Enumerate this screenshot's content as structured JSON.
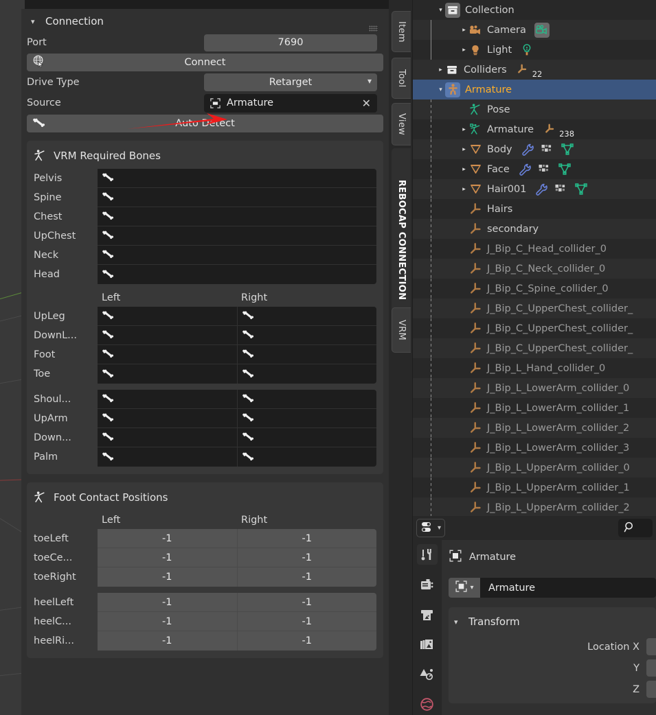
{
  "colors": {
    "accent_select": "#3b5680",
    "name_selected": "#ffaf29",
    "panel_bg": "#303030",
    "subpanel_bg": "#383838",
    "field_bg": "#545454",
    "dark_field_bg": "#1d1d1d",
    "annotation_arrow": "#ee1b1b"
  },
  "npanel": {
    "connection": {
      "title": "Connection",
      "port_label": "Port",
      "port_value": "7690",
      "connect_label": "Connect",
      "connect_icon": "globe-cursor-icon",
      "drive_type_label": "Drive Type",
      "drive_type_value": "Retarget",
      "source_label": "Source",
      "source_value": "Armature",
      "source_icon": "object-data-icon",
      "source_clear_icon": "x-icon",
      "auto_detect_label": "Auto Detect",
      "auto_detect_icon": "bone-icon",
      "grip_icon": "drag-grip-icon"
    },
    "required_bones": {
      "title": "VRM Required Bones",
      "title_icon": "armature-pose-icon",
      "center_rows": [
        "Pelvis",
        "Spine",
        "Chest",
        "UpChest",
        "Neck",
        "Head"
      ],
      "col_left": "Left",
      "col_right": "Right",
      "leg_rows": [
        "UpLeg",
        "DownL...",
        "Foot",
        "Toe"
      ],
      "arm_rows": [
        "Shoul...",
        "UpArm",
        "Down...",
        "Palm"
      ],
      "cell_icon": "bone-icon"
    },
    "foot_contact": {
      "title": "Foot Contact Positions",
      "title_icon": "armature-pose-icon",
      "col_left": "Left",
      "col_right": "Right",
      "toe_rows": [
        {
          "label": "toeLeft",
          "left": "-1",
          "right": "-1"
        },
        {
          "label": "toeCe...",
          "left": "-1",
          "right": "-1"
        },
        {
          "label": "toeRight",
          "left": "-1",
          "right": "-1"
        }
      ],
      "heel_rows": [
        {
          "label": "heelLeft",
          "left": "-1",
          "right": "-1"
        },
        {
          "label": "heelC...",
          "left": "-1",
          "right": "-1"
        },
        {
          "label": "heelRi...",
          "left": "-1",
          "right": "-1"
        }
      ]
    }
  },
  "tabs": [
    {
      "label": "Item",
      "active": false
    },
    {
      "label": "Tool",
      "active": false
    },
    {
      "label": "View",
      "active": false
    },
    {
      "label": "REBOCAP CONNECTION",
      "active": true
    },
    {
      "label": "VRM",
      "active": false
    }
  ],
  "outliner": {
    "rows": [
      {
        "name": "Collection",
        "indent": 0,
        "tri": "down",
        "icon": "collection-icon",
        "boxed": true,
        "selected": false,
        "dim": false,
        "extras": []
      },
      {
        "name": "Camera",
        "indent": 1,
        "tri": "right",
        "icon": "camera-object-icon",
        "boxed": false,
        "selected": false,
        "dim": false,
        "extras": [
          {
            "icon": "camera-data-icon",
            "boxed": true
          }
        ]
      },
      {
        "name": "Light",
        "indent": 1,
        "tri": "right",
        "icon": "light-object-icon",
        "boxed": false,
        "selected": false,
        "dim": false,
        "extras": [
          {
            "icon": "light-data-icon",
            "boxed": false
          }
        ]
      },
      {
        "name": "Colliders",
        "indent": 0,
        "tri": "right",
        "icon": "collection-icon",
        "boxed": false,
        "selected": false,
        "dim": false,
        "extras": [
          {
            "icon": "bone-group-icon",
            "badge": "22"
          }
        ]
      },
      {
        "name": "Armature",
        "indent": 0,
        "tri": "down",
        "icon": "armature-object-icon",
        "boxed": true,
        "selected": true,
        "dim": false,
        "extras": []
      },
      {
        "name": "Pose",
        "indent": 1,
        "tri": "none",
        "icon": "pose-icon",
        "boxed": false,
        "selected": false,
        "dim": false,
        "extras": []
      },
      {
        "name": "Armature",
        "indent": 1,
        "tri": "right",
        "icon": "armature-data-icon",
        "boxed": false,
        "selected": false,
        "dim": false,
        "extras": [
          {
            "icon": "bone-group-icon",
            "badge": "238"
          }
        ]
      },
      {
        "name": "Body",
        "indent": 1,
        "tri": "right",
        "icon": "mesh-object-icon",
        "boxed": false,
        "selected": false,
        "dim": false,
        "extras": [
          {
            "icon": "wrench-modifier-icon"
          },
          {
            "icon": "material-icon"
          },
          {
            "icon": "mesh-data-icon"
          }
        ]
      },
      {
        "name": "Face",
        "indent": 1,
        "tri": "right",
        "icon": "mesh-object-icon",
        "boxed": false,
        "selected": false,
        "dim": false,
        "extras": [
          {
            "icon": "wrench-modifier-icon"
          },
          {
            "icon": "material-icon"
          },
          {
            "icon": "mesh-data-icon"
          }
        ]
      },
      {
        "name": "Hair001",
        "indent": 1,
        "tri": "right",
        "icon": "mesh-object-icon",
        "boxed": false,
        "selected": false,
        "dim": false,
        "extras": [
          {
            "icon": "wrench-modifier-icon"
          },
          {
            "icon": "material-icon"
          },
          {
            "icon": "mesh-data-icon"
          }
        ]
      },
      {
        "name": "Hairs",
        "indent": 1,
        "tri": "none",
        "icon": "empty-axis-icon",
        "boxed": false,
        "selected": false,
        "dim": false,
        "extras": []
      },
      {
        "name": "secondary",
        "indent": 1,
        "tri": "none",
        "icon": "empty-axis-icon",
        "boxed": false,
        "selected": false,
        "dim": false,
        "extras": []
      },
      {
        "name": "J_Bip_C_Head_collider_0",
        "indent": 1,
        "tri": "none",
        "icon": "empty-axis-icon",
        "boxed": false,
        "selected": false,
        "dim": true,
        "extras": []
      },
      {
        "name": "J_Bip_C_Neck_collider_0",
        "indent": 1,
        "tri": "none",
        "icon": "empty-axis-icon",
        "boxed": false,
        "selected": false,
        "dim": true,
        "extras": []
      },
      {
        "name": "J_Bip_C_Spine_collider_0",
        "indent": 1,
        "tri": "none",
        "icon": "empty-axis-icon",
        "boxed": false,
        "selected": false,
        "dim": true,
        "extras": []
      },
      {
        "name": "J_Bip_C_UpperChest_collider_",
        "indent": 1,
        "tri": "none",
        "icon": "empty-axis-icon",
        "boxed": false,
        "selected": false,
        "dim": true,
        "extras": []
      },
      {
        "name": "J_Bip_C_UpperChest_collider_",
        "indent": 1,
        "tri": "none",
        "icon": "empty-axis-icon",
        "boxed": false,
        "selected": false,
        "dim": true,
        "extras": []
      },
      {
        "name": "J_Bip_C_UpperChest_collider_",
        "indent": 1,
        "tri": "none",
        "icon": "empty-axis-icon",
        "boxed": false,
        "selected": false,
        "dim": true,
        "extras": []
      },
      {
        "name": "J_Bip_L_Hand_collider_0",
        "indent": 1,
        "tri": "none",
        "icon": "empty-axis-icon",
        "boxed": false,
        "selected": false,
        "dim": true,
        "extras": []
      },
      {
        "name": "J_Bip_L_LowerArm_collider_0",
        "indent": 1,
        "tri": "none",
        "icon": "empty-axis-icon",
        "boxed": false,
        "selected": false,
        "dim": true,
        "extras": []
      },
      {
        "name": "J_Bip_L_LowerArm_collider_1",
        "indent": 1,
        "tri": "none",
        "icon": "empty-axis-icon",
        "boxed": false,
        "selected": false,
        "dim": true,
        "extras": []
      },
      {
        "name": "J_Bip_L_LowerArm_collider_2",
        "indent": 1,
        "tri": "none",
        "icon": "empty-axis-icon",
        "boxed": false,
        "selected": false,
        "dim": true,
        "extras": []
      },
      {
        "name": "J_Bip_L_LowerArm_collider_3",
        "indent": 1,
        "tri": "none",
        "icon": "empty-axis-icon",
        "boxed": false,
        "selected": false,
        "dim": true,
        "extras": []
      },
      {
        "name": "J_Bip_L_UpperArm_collider_0",
        "indent": 1,
        "tri": "none",
        "icon": "empty-axis-icon",
        "boxed": false,
        "selected": false,
        "dim": true,
        "extras": []
      },
      {
        "name": "J_Bip_L_UpperArm_collider_1",
        "indent": 1,
        "tri": "none",
        "icon": "empty-axis-icon",
        "boxed": false,
        "selected": false,
        "dim": true,
        "extras": []
      },
      {
        "name": "J_Bip_L_UpperArm_collider_2",
        "indent": 1,
        "tri": "none",
        "icon": "empty-axis-icon",
        "boxed": false,
        "selected": false,
        "dim": true,
        "extras": []
      }
    ]
  },
  "properties": {
    "editor_type_icon": "editor-type-icon",
    "search_icon": "search-icon",
    "tabs": [
      {
        "icon": "tool-icon",
        "active": true
      },
      {
        "icon": "render-icon",
        "active": false
      },
      {
        "icon": "output-icon",
        "active": false
      },
      {
        "icon": "view-layer-icon",
        "active": false
      },
      {
        "icon": "scene-icon",
        "active": false
      },
      {
        "icon": "world-icon",
        "active": false
      }
    ],
    "breadcrumb": {
      "icon": "object-icon",
      "label": "Armature"
    },
    "id_block": {
      "icon": "object-icon",
      "dropdown_icon": "chevron-down-icon",
      "name": "Armature"
    },
    "transform": {
      "title": "Transform",
      "rows": [
        "Location X",
        "Y",
        "Z"
      ]
    }
  }
}
